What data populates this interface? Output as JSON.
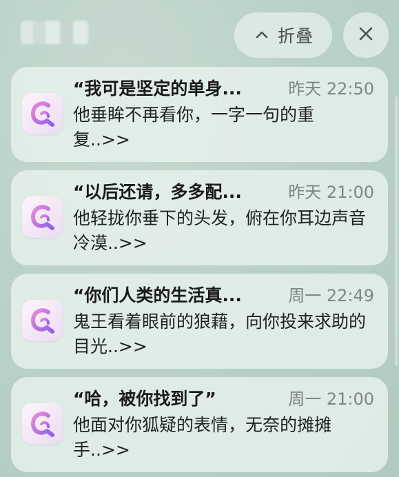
{
  "header": {
    "collapse_label": "折叠",
    "collapse_icon": "chevron-up-icon",
    "close_icon": "close-icon"
  },
  "colors": {
    "background": "#b9d0c6",
    "card": "#e8f2ed",
    "icon_gradient_start": "#e88bd8",
    "icon_gradient_end": "#8f5fe6"
  },
  "notifications": [
    {
      "title": "“我可是坚定的单身...",
      "time": "昨天 22:50",
      "body": "他垂眸不再看你，一字一句的重复..>>"
    },
    {
      "title": "“以后还请，多多配...",
      "time": "昨天 21:00",
      "body": "他轻拢你垂下的头发，俯在你耳边声音冷漠..>>"
    },
    {
      "title": "“你们人类的生活真...",
      "time": "周一 22:49",
      "body": "鬼王看着眼前的狼藉，向你投来求助的目光..>>"
    },
    {
      "title": "“哈，被你找到了”",
      "time": "周一 21:00",
      "body": "他面对你狐疑的表情，无奈的摊摊手..>>"
    }
  ]
}
